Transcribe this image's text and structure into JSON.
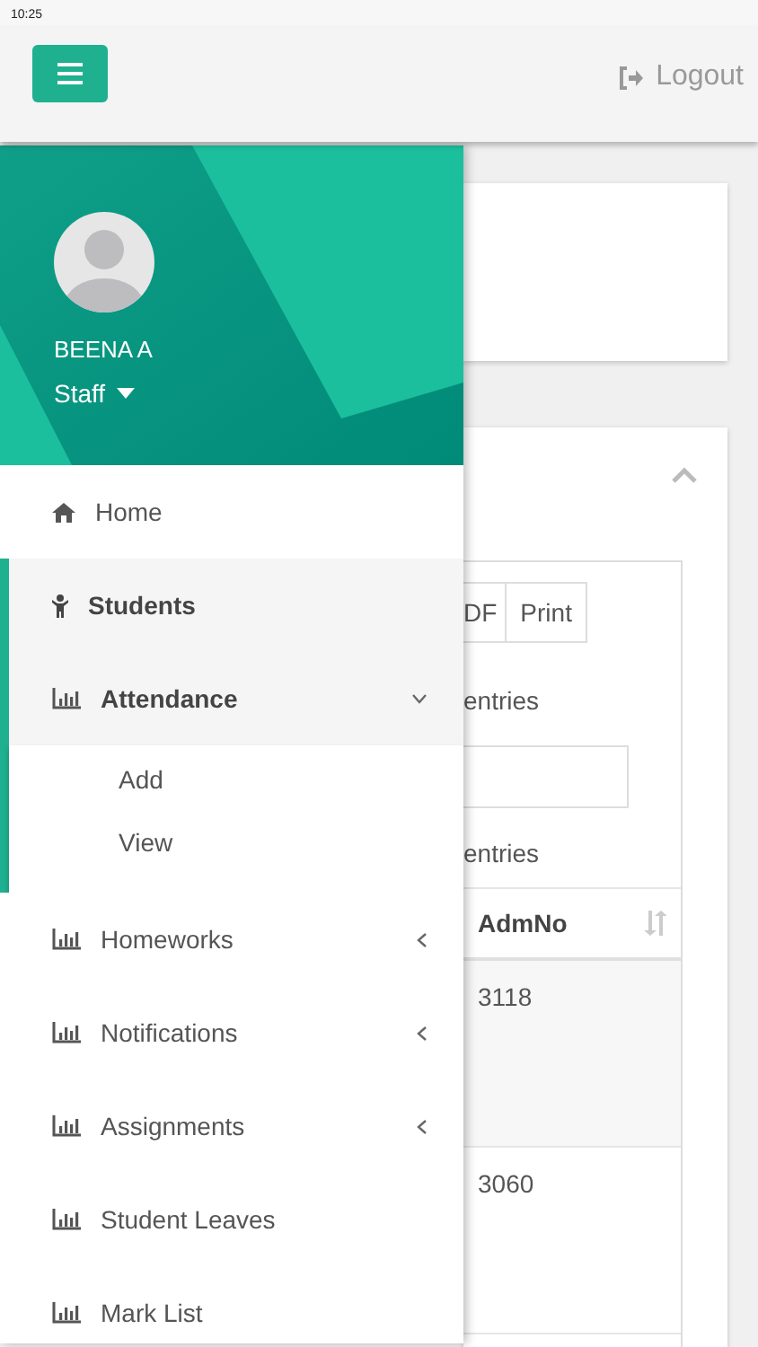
{
  "status_bar": {
    "time": "10:25"
  },
  "navbar": {
    "logout": "Logout"
  },
  "sidebar": {
    "user": {
      "name": "BEENA A",
      "role": "Staff"
    },
    "items": [
      {
        "label": "Home",
        "kind": "home",
        "active": false
      },
      {
        "label": "Students",
        "kind": "person",
        "active": true
      },
      {
        "label": "Attendance",
        "kind": "chart",
        "active": true,
        "expanded": true,
        "children": [
          {
            "label": "Add"
          },
          {
            "label": "View"
          }
        ]
      },
      {
        "label": "Homeworks",
        "kind": "chart",
        "active": false,
        "expanded": false
      },
      {
        "label": "Notifications",
        "kind": "chart",
        "active": false,
        "expanded": false
      },
      {
        "label": "Assignments",
        "kind": "chart",
        "active": false,
        "expanded": false
      },
      {
        "label": "Student Leaves",
        "kind": "chart",
        "active": false
      },
      {
        "label": "Mark List",
        "kind": "chart",
        "active": false
      }
    ]
  },
  "content": {
    "export_buttons": [
      "DF",
      "Print"
    ],
    "entries_top": "entries",
    "entries_bottom": "entries",
    "table": {
      "columns": [
        "AdmNo"
      ],
      "rows": [
        [
          "3118"
        ],
        [
          "3060"
        ]
      ]
    }
  }
}
